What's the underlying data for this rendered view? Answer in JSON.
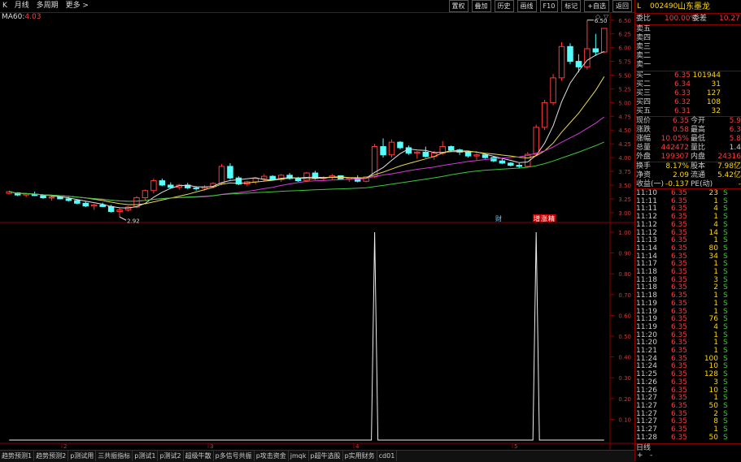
{
  "toolbar": {
    "left_items": [
      "K",
      "月线",
      "多周期",
      "更多 >"
    ],
    "right_buttons": [
      "置权",
      "叠加",
      "历史",
      "画线",
      "F10",
      "标记",
      "+自选",
      "返回"
    ]
  },
  "ma_label": {
    "name": "MA60:",
    "value": "4.03"
  },
  "chart_labels": {
    "high_marker": "6.50",
    "low_marker": "2.92",
    "cai": "财",
    "zeng": "增",
    "zhang": "涨",
    "sheng": "精"
  },
  "price_axis": [
    "6.50",
    "6.25",
    "6.00",
    "5.75",
    "5.50",
    "5.25",
    "5.00",
    "4.75",
    "4.50",
    "4.25",
    "4.00",
    "3.75",
    "3.50",
    "3.25",
    "3.00"
  ],
  "indicator_axis": [
    "1.00",
    "0.90",
    "0.80",
    "0.70",
    "0.60",
    "0.50",
    "0.40",
    "0.30",
    "0.20",
    "0.10"
  ],
  "time_axis": [
    "2",
    "3",
    "4",
    "5"
  ],
  "bottom_tabs": [
    "趋势预测1",
    "趋势预测2",
    "p测试用",
    "三共振指标",
    "p测试1",
    "p测试2",
    "超级牛散",
    "p多信号共振",
    "p攻击资金",
    "jmqk",
    "p超牛选股",
    "p实用财务",
    "cd01"
  ],
  "chart_data": [
    {
      "type": "candlestick",
      "title": "",
      "ylim": [
        2.85,
        6.6
      ],
      "candles": [
        [
          3.35,
          3.4,
          3.33,
          3.38
        ],
        [
          3.36,
          3.37,
          3.3,
          3.32
        ],
        [
          3.32,
          3.36,
          3.28,
          3.34
        ],
        [
          3.33,
          3.38,
          3.3,
          3.31
        ],
        [
          3.31,
          3.33,
          3.25,
          3.27
        ],
        [
          3.27,
          3.3,
          3.22,
          3.28
        ],
        [
          3.28,
          3.31,
          3.24,
          3.25
        ],
        [
          3.25,
          3.28,
          3.2,
          3.22
        ],
        [
          3.22,
          3.24,
          3.15,
          3.17
        ],
        [
          3.17,
          3.2,
          3.1,
          3.12
        ],
        [
          3.12,
          3.16,
          3.05,
          3.14
        ],
        [
          3.14,
          3.18,
          3.1,
          3.11
        ],
        [
          3.11,
          3.14,
          3.0,
          3.02
        ],
        [
          3.02,
          3.08,
          2.92,
          3.05
        ],
        [
          3.05,
          3.12,
          3.02,
          3.1
        ],
        [
          3.1,
          3.3,
          3.08,
          3.27
        ],
        [
          3.27,
          3.42,
          3.22,
          3.4
        ],
        [
          3.4,
          3.62,
          3.35,
          3.58
        ],
        [
          3.58,
          3.62,
          3.48,
          3.5
        ],
        [
          3.5,
          3.55,
          3.44,
          3.46
        ],
        [
          3.46,
          3.52,
          3.42,
          3.5
        ],
        [
          3.5,
          3.54,
          3.43,
          3.45
        ],
        [
          3.45,
          3.48,
          3.4,
          3.44
        ],
        [
          3.44,
          3.5,
          3.4,
          3.47
        ],
        [
          3.47,
          3.55,
          3.44,
          3.53
        ],
        [
          3.53,
          3.88,
          3.5,
          3.84
        ],
        [
          3.84,
          3.9,
          3.6,
          3.63
        ],
        [
          3.63,
          3.66,
          3.5,
          3.52
        ],
        [
          3.52,
          3.58,
          3.48,
          3.56
        ],
        [
          3.56,
          3.64,
          3.52,
          3.62
        ],
        [
          3.62,
          3.7,
          3.58,
          3.66
        ],
        [
          3.66,
          3.68,
          3.58,
          3.6
        ],
        [
          3.6,
          3.7,
          3.56,
          3.68
        ],
        [
          3.68,
          3.72,
          3.6,
          3.62
        ],
        [
          3.62,
          3.65,
          3.56,
          3.58
        ],
        [
          3.58,
          3.74,
          3.56,
          3.72
        ],
        [
          3.72,
          3.76,
          3.6,
          3.62
        ],
        [
          3.62,
          3.66,
          3.58,
          3.64
        ],
        [
          3.64,
          3.7,
          3.6,
          3.67
        ],
        [
          3.67,
          3.68,
          3.6,
          3.61
        ],
        [
          3.61,
          3.64,
          3.56,
          3.63
        ],
        [
          3.63,
          3.68,
          3.55,
          3.57
        ],
        [
          3.57,
          3.66,
          3.55,
          3.65
        ],
        [
          3.65,
          4.25,
          3.63,
          4.2
        ],
        [
          4.2,
          4.35,
          4.0,
          4.05
        ],
        [
          4.05,
          4.33,
          4.0,
          4.28
        ],
        [
          4.28,
          4.3,
          4.15,
          4.18
        ],
        [
          4.18,
          4.22,
          4.05,
          4.08
        ],
        [
          4.08,
          4.12,
          3.98,
          4.1
        ],
        [
          4.1,
          4.2,
          4.0,
          4.02
        ],
        [
          4.02,
          4.12,
          3.96,
          4.08
        ],
        [
          4.08,
          4.3,
          4.05,
          4.2
        ],
        [
          4.2,
          4.22,
          4.1,
          4.14
        ],
        [
          4.14,
          4.16,
          4.05,
          4.1
        ],
        [
          4.1,
          4.12,
          4.0,
          4.03
        ],
        [
          4.03,
          4.08,
          3.96,
          4.05
        ],
        [
          4.05,
          4.06,
          3.98,
          4.0
        ],
        [
          4.0,
          4.02,
          3.92,
          3.94
        ],
        [
          3.94,
          3.98,
          3.88,
          3.9
        ],
        [
          3.9,
          3.92,
          3.84,
          3.86
        ],
        [
          3.86,
          3.9,
          3.8,
          3.84
        ],
        [
          3.84,
          4.1,
          3.82,
          4.06
        ],
        [
          4.06,
          4.6,
          4.03,
          4.55
        ],
        [
          4.55,
          5.05,
          4.5,
          5.0
        ],
        [
          5.0,
          5.52,
          4.95,
          5.45
        ],
        [
          5.45,
          6.1,
          5.4,
          6.02
        ],
        [
          6.02,
          6.08,
          5.7,
          5.75
        ],
        [
          5.75,
          5.88,
          5.55,
          5.65
        ],
        [
          5.65,
          6.5,
          5.6,
          5.98
        ],
        [
          5.98,
          6.25,
          5.85,
          5.92
        ],
        [
          5.92,
          6.35,
          5.9,
          6.35
        ]
      ],
      "series": [
        {
          "name": "MA60",
          "value": 4.03
        }
      ]
    },
    {
      "type": "line",
      "title": "",
      "ylim": [
        0,
        1.0
      ],
      "values": [
        0,
        0,
        0,
        0,
        0,
        0,
        0,
        0,
        0,
        0,
        0,
        0,
        0,
        0,
        0,
        0,
        0,
        0,
        0,
        0,
        0,
        0,
        0,
        0,
        0,
        0,
        0,
        0,
        0,
        0,
        0,
        0,
        0,
        0,
        0,
        0,
        0,
        0,
        0,
        0,
        0,
        0,
        0,
        1,
        0,
        0,
        0,
        0,
        0,
        0,
        0,
        0,
        0,
        0,
        0,
        0,
        0,
        0,
        0,
        0,
        0,
        0,
        1,
        0,
        0,
        0,
        0,
        0,
        0,
        0,
        0
      ]
    }
  ],
  "stock": {
    "code": "002490",
    "name": "山东墨龙",
    "prefix": "L"
  },
  "weibi": {
    "label": "委比",
    "value": "100.00%",
    "label2": "委差",
    "value2": "10.27"
  },
  "sell_orders": [
    "卖五",
    "卖四",
    "卖三",
    "卖二",
    "卖一"
  ],
  "buy_orders": [
    {
      "label": "买一",
      "price": "6.35",
      "vol": "101944"
    },
    {
      "label": "买二",
      "price": "6.34",
      "vol": "31"
    },
    {
      "label": "买三",
      "price": "6.33",
      "vol": "127"
    },
    {
      "label": "买四",
      "price": "6.32",
      "vol": "108"
    },
    {
      "label": "买五",
      "price": "6.31",
      "vol": "32"
    }
  ],
  "quote": [
    {
      "l": "现价",
      "v": "6.35",
      "l2": "今开",
      "v2": "5.9"
    },
    {
      "l": "涨跌",
      "v": "0.58",
      "l2": "最高",
      "v2": "6.3"
    },
    {
      "l": "涨幅",
      "v": "10.05%",
      "l2": "最低",
      "v2": "5.8"
    },
    {
      "l": "总量",
      "v": "442472",
      "l2": "量比",
      "v2": "1.4"
    },
    {
      "l": "外盘",
      "v": "199307",
      "l2": "内盘",
      "v2": "24316"
    }
  ],
  "fundamental": [
    {
      "l": "换手",
      "v": "8.17%",
      "l2": "股本",
      "v2": "7.98亿"
    },
    {
      "l": "净资",
      "v": "2.09",
      "l2": "流通",
      "v2": "5.42亿"
    },
    {
      "l": "收益(一)",
      "v": "-0.137",
      "l2": "PE(动)",
      "v2": "-"
    }
  ],
  "ticks": [
    [
      "11:10",
      "6.35",
      "23",
      "S"
    ],
    [
      "11:11",
      "6.35",
      "1",
      "S"
    ],
    [
      "11:11",
      "6.35",
      "4",
      "S"
    ],
    [
      "11:12",
      "6.35",
      "1",
      "S"
    ],
    [
      "11:12",
      "6.35",
      "4",
      "S"
    ],
    [
      "11:12",
      "6.35",
      "14",
      "S"
    ],
    [
      "11:13",
      "6.35",
      "1",
      "S"
    ],
    [
      "11:14",
      "6.35",
      "80",
      "S"
    ],
    [
      "11:14",
      "6.35",
      "34",
      "S"
    ],
    [
      "11:17",
      "6.35",
      "1",
      "S"
    ],
    [
      "11:18",
      "6.35",
      "1",
      "S"
    ],
    [
      "11:18",
      "6.35",
      "3",
      "S"
    ],
    [
      "11:18",
      "6.35",
      "2",
      "S"
    ],
    [
      "11:18",
      "6.35",
      "1",
      "S"
    ],
    [
      "11:19",
      "6.35",
      "1",
      "S"
    ],
    [
      "11:19",
      "6.35",
      "1",
      "S"
    ],
    [
      "11:19",
      "6.35",
      "76",
      "S"
    ],
    [
      "11:19",
      "6.35",
      "4",
      "S"
    ],
    [
      "11:20",
      "6.35",
      "1",
      "S"
    ],
    [
      "11:20",
      "6.35",
      "1",
      "S"
    ],
    [
      "11:21",
      "6.35",
      "1",
      "S"
    ],
    [
      "11:24",
      "6.35",
      "100",
      "S"
    ],
    [
      "11:24",
      "6.35",
      "10",
      "S"
    ],
    [
      "11:25",
      "6.35",
      "128",
      "S"
    ],
    [
      "11:26",
      "6.35",
      "3",
      "S"
    ],
    [
      "11:26",
      "6.35",
      "10",
      "S"
    ],
    [
      "11:27",
      "6.35",
      "1",
      "S"
    ],
    [
      "11:27",
      "6.35",
      "50",
      "S"
    ],
    [
      "11:27",
      "6.35",
      "2",
      "S"
    ],
    [
      "11:27",
      "6.35",
      "8",
      "S"
    ],
    [
      "11:27",
      "6.35",
      "1",
      "S"
    ],
    [
      "11:28",
      "6.35",
      "50",
      "S"
    ]
  ],
  "tick_footer": {
    "plus": "+",
    "minus": "-",
    "daily": "日线"
  }
}
